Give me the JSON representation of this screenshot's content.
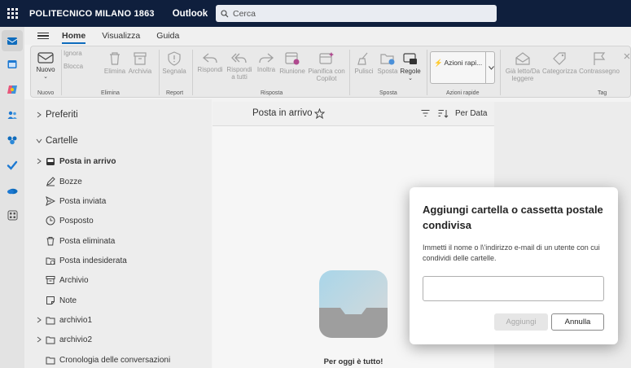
{
  "topbar": {
    "org_name": "POLITECNICO MILANO 1863",
    "app_name": "Outlook",
    "search_placeholder": "Cerca"
  },
  "menubar": {
    "tabs": [
      {
        "label": "Home",
        "active": true
      },
      {
        "label": "Visualizza",
        "active": false
      },
      {
        "label": "Guida",
        "active": false
      }
    ]
  },
  "ribbon": {
    "new_label": "Nuovo",
    "ignore_label": "Ignora",
    "block_label": "Blocca",
    "delete_label": "Elimina",
    "archive_label": "Archivia",
    "report_label": "Segnala",
    "reply_label": "Rispondi",
    "reply_all_label": "Rispondi a tutti",
    "forward_label": "Inoltra",
    "meeting_label": "Riunione",
    "copilot_label": "Pianifica con Copilot",
    "sweep_label": "Pulisci",
    "move_label": "Sposta",
    "rules_label": "Regole",
    "quick_steps_label": "Azioni rapi...",
    "read_label": "Già letto/Da leggere",
    "categorize_label": "Categorizza",
    "flag_label": "Contrassegno",
    "groups": {
      "new": "Nuovo",
      "delete": "Elimina",
      "report": "Report",
      "reply": "Risposta",
      "move": "Sposta",
      "quick": "Azioni rapide",
      "tag": "Tag"
    }
  },
  "folders": {
    "favorites": "Preferiti",
    "folders": "Cartelle",
    "items": [
      {
        "label": "Posta in arrivo",
        "icon": "inbox-icon"
      },
      {
        "label": "Bozze",
        "icon": "pencil-icon"
      },
      {
        "label": "Posta inviata",
        "icon": "send-icon"
      },
      {
        "label": "Posposto",
        "icon": "clock-icon"
      },
      {
        "label": "Posta eliminata",
        "icon": "trash-icon"
      },
      {
        "label": "Posta indesiderata",
        "icon": "junk-icon"
      },
      {
        "label": "Archivio",
        "icon": "archive-icon"
      },
      {
        "label": "Note",
        "icon": "note-icon"
      },
      {
        "label": "archivio1",
        "icon": "folder-icon"
      },
      {
        "label": "archivio2",
        "icon": "folder-icon"
      },
      {
        "label": "Cronologia delle conversazioni",
        "icon": "folder-icon"
      }
    ]
  },
  "message_list": {
    "title": "Posta in arrivo",
    "sort_label": "Per Data",
    "empty_text": "Per oggi è tutto!"
  },
  "dialog": {
    "title": "Aggiungi cartella o cassetta postale condivisa",
    "description": "Immetti il nome o l\\'indirizzo e-mail di un utente con cui condividi delle cartelle.",
    "input_value": "",
    "add_label": "Aggiungi",
    "cancel_label": "Annulla"
  },
  "colors": {
    "topbar": "#0f1f3d",
    "accent": "#0f6cbd"
  }
}
